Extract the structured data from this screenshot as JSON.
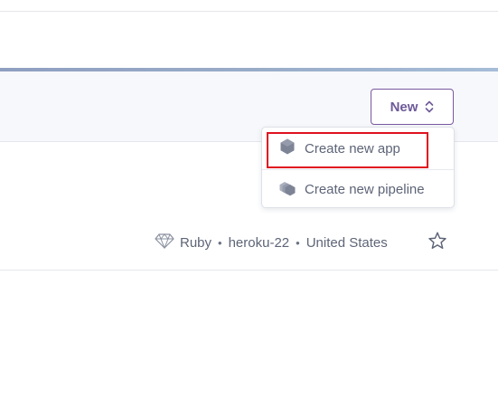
{
  "toolbar": {
    "new_button_label": "New",
    "new_button_icon": "chevron-updown-icon"
  },
  "dropdown": {
    "items": [
      {
        "label": "Create new app",
        "icon": "hexagon-icon"
      },
      {
        "label": "Create new pipeline",
        "icon": "stacked-hexagons-icon"
      }
    ]
  },
  "app": {
    "language": "Ruby",
    "stack": "heroku-22",
    "region": "United States",
    "separator": "•",
    "language_icon": "ruby-gem-icon",
    "favorite_icon": "star-icon"
  },
  "colors": {
    "accent": "#79589f",
    "highlight": "#e0121f",
    "text_muted": "#5d6477"
  }
}
